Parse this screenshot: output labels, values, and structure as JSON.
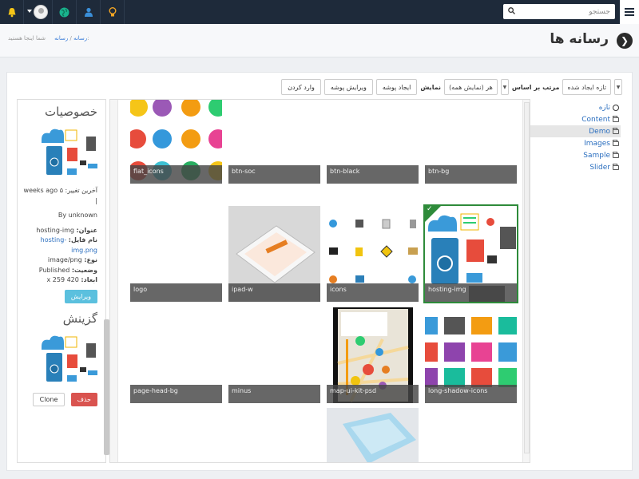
{
  "topbar": {
    "search_placeholder": "جستجو",
    "icons": [
      "menu-icon",
      "search-icon",
      "bell-icon",
      "user-avatar",
      "globe-icon",
      "user-icon",
      "lightbulb-icon"
    ],
    "colors": {
      "bar": "#1e2a3a",
      "bell": "#f5c518",
      "globe": "#19b38d",
      "user": "#3a8fd9",
      "bulb": "#f5a623"
    }
  },
  "header": {
    "title": "رسانه ها",
    "breadcrumb_prefix": "شما اینجا هستید:",
    "breadcrumb_1": "رسانه",
    "breadcrumb_sep": "/",
    "breadcrumb_2": "رسانه"
  },
  "toolbar": {
    "btn_import": "وارد کردن",
    "btn_edit_folder": "ویرایش پوشه",
    "btn_new_folder": "ایجاد پوشه",
    "show_label": "نمایش",
    "show_value": "هر (نمایش همه)",
    "sort_label": "مرتب بر اساس",
    "sort_value": "تازه ایجاد شده"
  },
  "tree": {
    "items": [
      {
        "label": "تازه",
        "icon": "new-icon"
      },
      {
        "label": "Content",
        "icon": "folder-icon"
      },
      {
        "label": "Demo",
        "icon": "folder-icon",
        "active": true
      },
      {
        "label": "Images",
        "icon": "folder-icon"
      },
      {
        "label": "Sample",
        "icon": "folder-open-icon"
      },
      {
        "label": "Slider",
        "icon": "folder-open-icon"
      }
    ]
  },
  "grid": {
    "tiles": [
      {
        "label": "flat_icons"
      },
      {
        "label": "btn-soc"
      },
      {
        "label": "btn-black"
      },
      {
        "label": "btn-bg"
      },
      {
        "label": "logo"
      },
      {
        "label": "ipad-w"
      },
      {
        "label": "icons"
      },
      {
        "label": "hosting-img",
        "selected": true
      },
      {
        "label": "page-head-bg"
      },
      {
        "label": "minus"
      },
      {
        "label": "map-ui-kit-psd"
      },
      {
        "label": "long-shadow-icons"
      }
    ]
  },
  "props": {
    "title": "خصوصیات",
    "modified": "آخرین تغییر: ۵ weeks ago |",
    "by": "By unknown",
    "k_title": "عنوان:",
    "v_title": "hosting-img",
    "k_file": "نام فایل:",
    "v_file": "hosting-img.png",
    "k_type": "نوع:",
    "v_type": "image/png",
    "k_status": "وضعیت:",
    "v_status": "Published",
    "k_dim": "ابعاد:",
    "v_dim": "420 x 259",
    "edit_btn": "ویرایش",
    "selection_title": "گزینش",
    "delete_btn": "حذف",
    "clone_btn": "Clone"
  }
}
